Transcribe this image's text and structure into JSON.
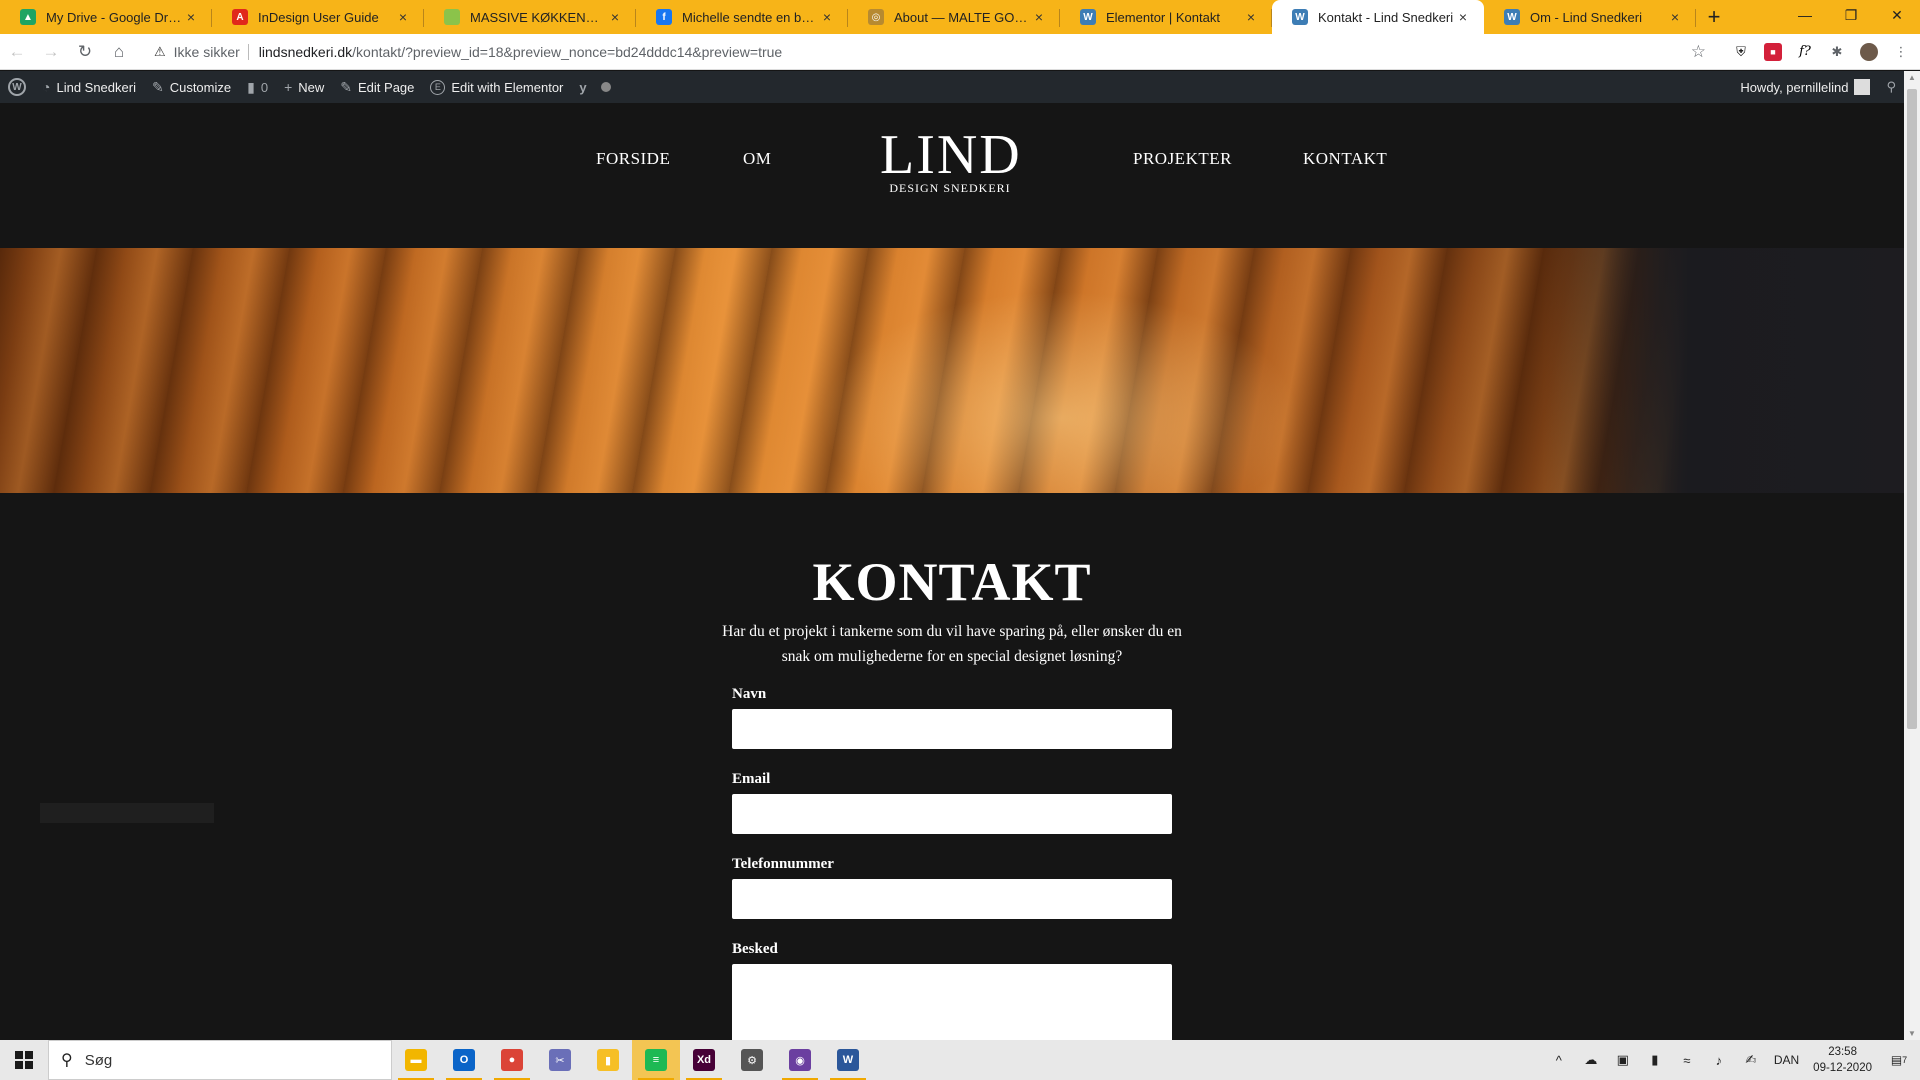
{
  "browser": {
    "tabs": [
      {
        "title": "My Drive - Google Drive",
        "favicon_color": "#1fa463",
        "favicon_glyph": "▲"
      },
      {
        "title": "InDesign User Guide",
        "favicon_color": "#e0281b",
        "favicon_glyph": "A"
      },
      {
        "title": "MASSIVE KØKKENER - Søgs",
        "favicon_color": "#8bc34a",
        "favicon_glyph": ""
      },
      {
        "title": "Michelle sendte en besked",
        "favicon_color": "#1877f2",
        "favicon_glyph": "f"
      },
      {
        "title": "About — MALTE GORMSEN",
        "favicon_color": "#b78a30",
        "favicon_glyph": "◎"
      },
      {
        "title": "Elementor | Kontakt",
        "favicon_color": "#3d7db5",
        "favicon_glyph": "W"
      },
      {
        "title": "Kontakt - Lind Snedkeri",
        "favicon_color": "#3d7db5",
        "favicon_glyph": "W",
        "active": true
      },
      {
        "title": "Om - Lind Snedkeri",
        "favicon_color": "#3d7db5",
        "favicon_glyph": "W"
      }
    ],
    "new_tab": "+",
    "window_controls": {
      "minimize": "—",
      "restore": "❐",
      "close": "✕"
    },
    "address": {
      "security_label": "Ikke sikker",
      "url_host": "lindsnedkeri.dk",
      "url_path": "/kontakt/?preview_id=18&preview_nonce=bd24dddc14&preview=true"
    }
  },
  "admin_bar": {
    "wp_logo": "W",
    "site_name": "Lind Snedkeri",
    "customize": "Customize",
    "comments_count": "0",
    "new": "New",
    "edit_page": "Edit Page",
    "edit_elementor": "Edit with Elementor",
    "howdy": "Howdy, pernillelind"
  },
  "site": {
    "nav": {
      "forside": "FORSIDE",
      "om": "OM",
      "projekter": "PROJEKTER",
      "kontakt": "KONTAKT"
    },
    "logo": {
      "main": "LIND",
      "sub": "DESIGN SNEDKERI"
    },
    "contact": {
      "title": "KONTAKT",
      "intro": "Har du et projekt i tankerne som du vil have sparing på, eller ønsker du en snak om mulighederne for en special designet løsning?",
      "fields": {
        "name_label": "Navn",
        "email_label": "Email",
        "phone_label": "Telefonnummer",
        "message_label": "Besked"
      }
    }
  },
  "taskbar": {
    "search_placeholder": "Søg",
    "apps": [
      {
        "name": "file-explorer",
        "color": "#f2b600",
        "glyph": "▬"
      },
      {
        "name": "outlook",
        "color": "#0a64c8",
        "glyph": "O"
      },
      {
        "name": "chrome",
        "color": "#db4437",
        "glyph": "●"
      },
      {
        "name": "snipping-tool",
        "color": "#6a6fb8",
        "glyph": "✂"
      },
      {
        "name": "google-keep",
        "color": "#f6bf26",
        "glyph": "▮"
      },
      {
        "name": "spotify",
        "color": "#1db954",
        "glyph": "≡"
      },
      {
        "name": "adobe-xd",
        "color": "#470137",
        "glyph": "Xd"
      },
      {
        "name": "settings",
        "color": "#555555",
        "glyph": "⚙"
      },
      {
        "name": "app-purple",
        "color": "#6b3fa0",
        "glyph": "◉"
      },
      {
        "name": "word",
        "color": "#2b579a",
        "glyph": "W"
      }
    ],
    "tray": {
      "language": "DAN",
      "time": "23:58",
      "date": "09-12-2020",
      "notifications": "7"
    }
  }
}
